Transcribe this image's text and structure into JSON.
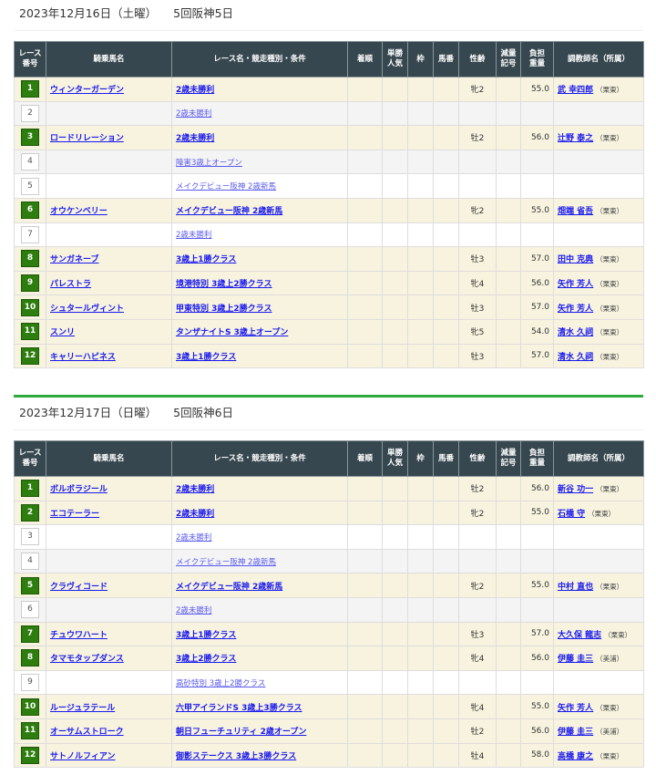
{
  "headers": [
    "レース\n番号",
    "騎乗馬名",
    "レース名・競走種別・条件",
    "着順",
    "単勝\n人気",
    "枠",
    "馬番",
    "性齢",
    "減量\n記号",
    "負担\n重量",
    "調教師名（所属）"
  ],
  "days": [
    {
      "date": "2023年12月16日（土曜）",
      "meeting": "5回阪神5日",
      "rows": [
        {
          "no": "1",
          "horse": "ウィンターガーデン",
          "race": "2歳未勝利",
          "sexage": "牝2",
          "weight": "55.0",
          "trainer": "武 幸四郎",
          "aff": "（栗東）"
        },
        {
          "no": "2",
          "horse": "",
          "race": "2歳未勝利"
        },
        {
          "no": "3",
          "horse": "ロードリレーション",
          "race": "2歳未勝利",
          "sexage": "牡2",
          "weight": "56.0",
          "trainer": "辻野 泰之",
          "aff": "（栗東）"
        },
        {
          "no": "4",
          "horse": "",
          "race": "障害3歳上オープン"
        },
        {
          "no": "5",
          "horse": "",
          "race": "メイクデビュー阪神 2歳新馬"
        },
        {
          "no": "6",
          "horse": "オウケンベリー",
          "race": "メイクデビュー阪神 2歳新馬",
          "sexage": "牝2",
          "weight": "55.0",
          "trainer": "畑端 省吾",
          "aff": "（栗東）"
        },
        {
          "no": "7",
          "horse": "",
          "race": "2歳未勝利"
        },
        {
          "no": "8",
          "horse": "サンガネーブ",
          "race": "3歳上1勝クラス",
          "sexage": "牡3",
          "weight": "57.0",
          "trainer": "田中 克典",
          "aff": "（栗東）"
        },
        {
          "no": "9",
          "horse": "パレストラ",
          "race": "境港特別 3歳上2勝クラス",
          "sexage": "牝4",
          "weight": "56.0",
          "trainer": "矢作 芳人",
          "aff": "（栗東）"
        },
        {
          "no": "10",
          "horse": "シュタールヴィント",
          "race": "甲東特別 3歳上2勝クラス",
          "sexage": "牡3",
          "weight": "57.0",
          "trainer": "矢作 芳人",
          "aff": "（栗東）"
        },
        {
          "no": "11",
          "horse": "スンリ",
          "race": "タンザナイトS 3歳上オープン",
          "sexage": "牝5",
          "weight": "54.0",
          "trainer": "清水 久詞",
          "aff": "（栗東）"
        },
        {
          "no": "12",
          "horse": "キャリーハピネス",
          "race": "3歳上1勝クラス",
          "sexage": "牡3",
          "weight": "57.0",
          "trainer": "清水 久詞",
          "aff": "（栗東）"
        }
      ]
    },
    {
      "date": "2023年12月17日（日曜）",
      "meeting": "5回阪神6日",
      "rows": [
        {
          "no": "1",
          "horse": "ボルボラジール",
          "race": "2歳未勝利",
          "sexage": "牡2",
          "weight": "56.0",
          "trainer": "新谷 功一",
          "aff": "（栗東）"
        },
        {
          "no": "2",
          "horse": "エコテーラー",
          "race": "2歳未勝利",
          "sexage": "牝2",
          "weight": "55.0",
          "trainer": "石橋 守",
          "aff": "（栗東）"
        },
        {
          "no": "3",
          "horse": "",
          "race": "2歳未勝利"
        },
        {
          "no": "4",
          "horse": "",
          "race": "メイクデビュー阪神 2歳新馬"
        },
        {
          "no": "5",
          "horse": "クラヴィコード",
          "race": "メイクデビュー阪神 2歳新馬",
          "sexage": "牝2",
          "weight": "55.0",
          "trainer": "中村 直也",
          "aff": "（栗東）"
        },
        {
          "no": "6",
          "horse": "",
          "race": "2歳未勝利"
        },
        {
          "no": "7",
          "horse": "チュウワハート",
          "race": "3歳上1勝クラス",
          "sexage": "牡3",
          "weight": "57.0",
          "trainer": "大久保 龍志",
          "aff": "（栗東）"
        },
        {
          "no": "8",
          "horse": "タマモタップダンス",
          "race": "3歳上2勝クラス",
          "sexage": "牝4",
          "weight": "56.0",
          "trainer": "伊藤 圭三",
          "aff": "（美浦）"
        },
        {
          "no": "9",
          "horse": "",
          "race": "高砂特別 3歳上2勝クラス"
        },
        {
          "no": "10",
          "horse": "ルージュラテール",
          "race": "六甲アイランドS 3歳上3勝クラス",
          "sexage": "牝4",
          "weight": "55.0",
          "trainer": "矢作 芳人",
          "aff": "（栗東）"
        },
        {
          "no": "11",
          "horse": "オーサムストローク",
          "race": "朝日フューチュリティ 2歳オープン",
          "sexage": "牡2",
          "weight": "56.0",
          "trainer": "伊藤 圭三",
          "aff": "（美浦）"
        },
        {
          "no": "12",
          "horse": "サトノルフィアン",
          "race": "御影ステークス 3歳上3勝クラス",
          "sexage": "牡4",
          "weight": "58.0",
          "trainer": "高橋 康之",
          "aff": "（栗東）"
        }
      ]
    }
  ]
}
